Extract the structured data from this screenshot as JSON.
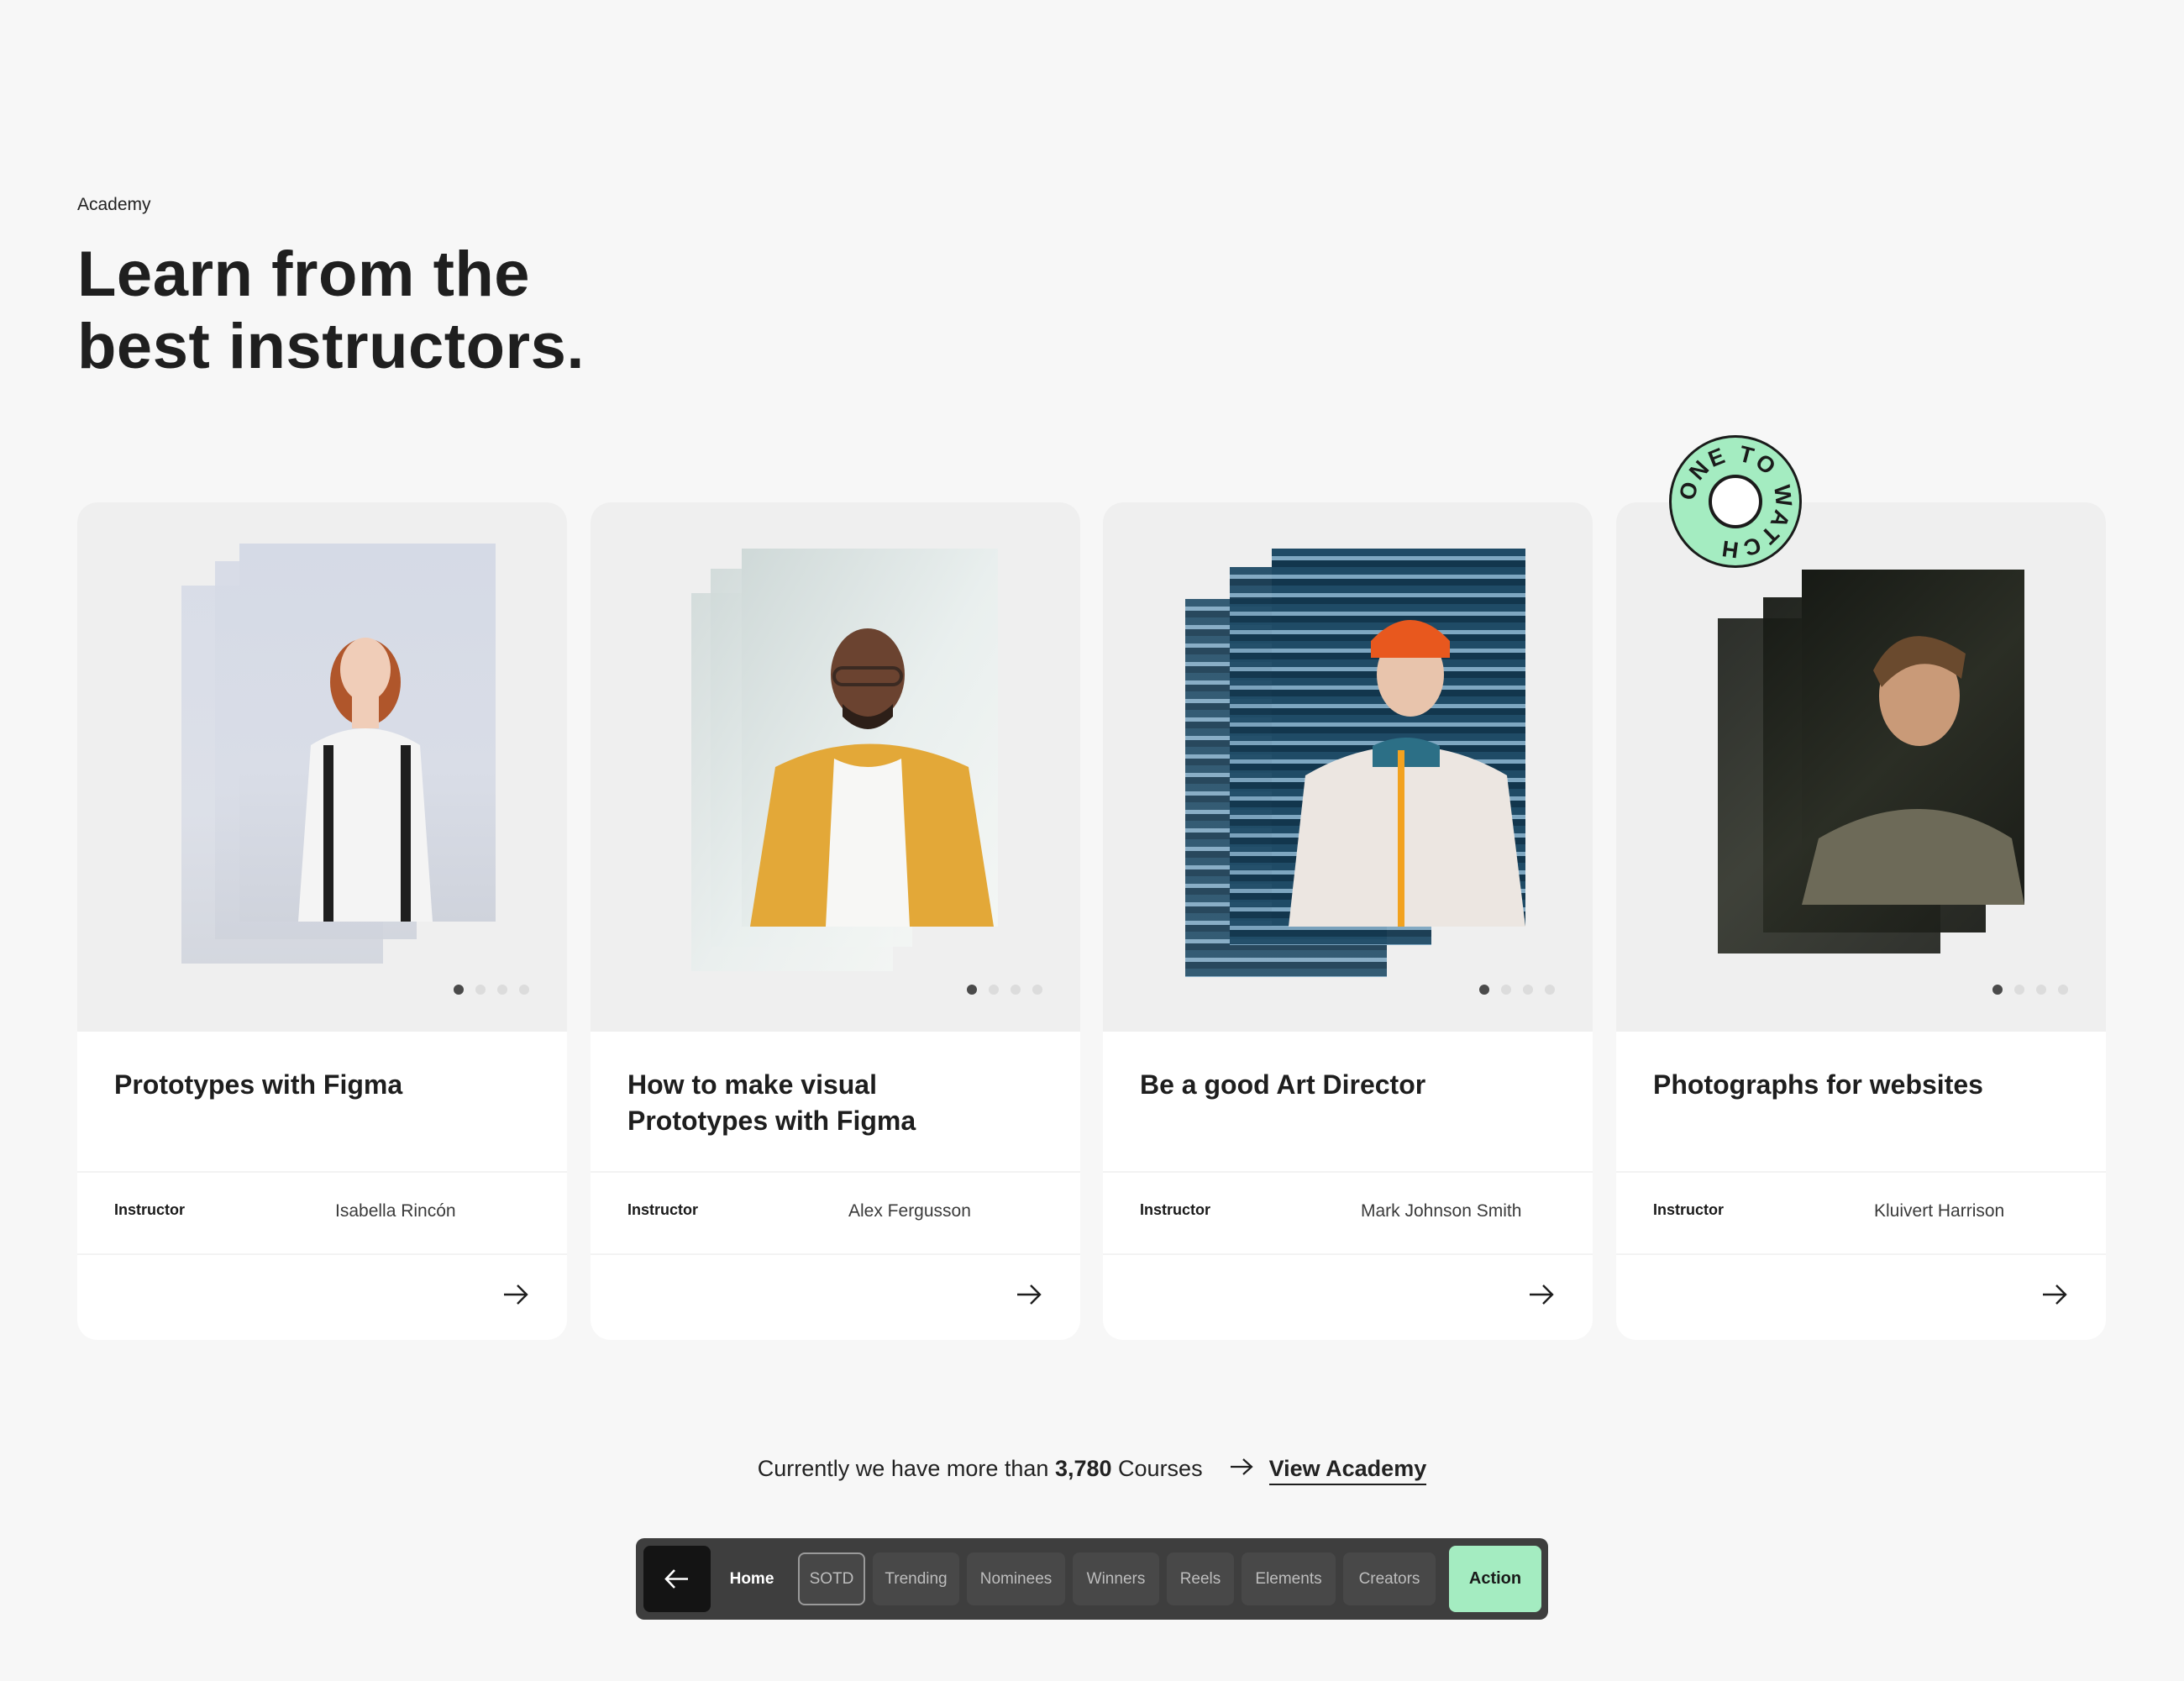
{
  "section": {
    "eyebrow": "Academy",
    "headline_line1": "Learn from the",
    "headline_line2": "best instructors."
  },
  "badge": {
    "text": "ONE TO WATCH",
    "color": "#a4ecc1"
  },
  "cards": [
    {
      "title_line1": "Prototypes with Figma",
      "title_line2": "",
      "instructor_label": "Instructor",
      "instructor": "Isabella Rincón",
      "active_slide": 1,
      "slides": 4
    },
    {
      "title_line1": "How to make visual",
      "title_line2": "Prototypes with Figma",
      "instructor_label": "Instructor",
      "instructor": "Alex Fergusson",
      "active_slide": 1,
      "slides": 4
    },
    {
      "title_line1": "Be a good Art Director",
      "title_line2": "",
      "instructor_label": "Instructor",
      "instructor": "Mark Johnson Smith",
      "active_slide": 1,
      "slides": 4
    },
    {
      "title_line1": "Photographs for websites",
      "title_line2": "",
      "instructor_label": "Instructor",
      "instructor": "Kluivert Harrison",
      "active_slide": 1,
      "slides": 4
    }
  ],
  "footer": {
    "text_before": "Currently we have more than ",
    "count": "3,780",
    "text_after": " Courses",
    "link": "View Academy"
  },
  "nav": {
    "back_icon": "arrow-left-icon",
    "home": "Home",
    "items": [
      "SOTD",
      "Trending",
      "Nominees",
      "Winners",
      "Reels",
      "Elements",
      "Creators"
    ],
    "action": "Action",
    "accent": "#a4ecc1"
  }
}
